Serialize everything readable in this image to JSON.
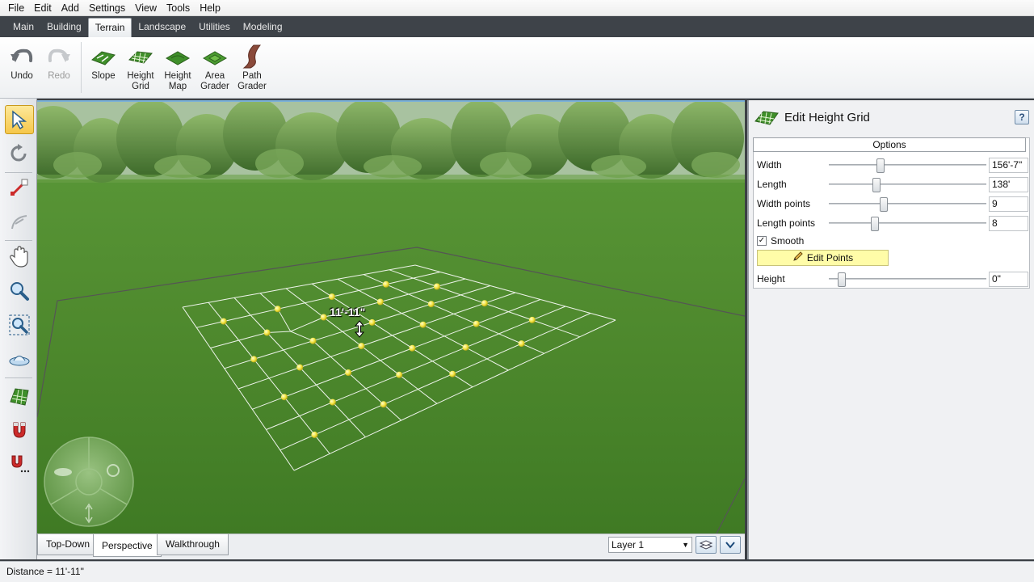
{
  "menu": [
    "File",
    "Edit",
    "Add",
    "Settings",
    "View",
    "Tools",
    "Help"
  ],
  "tabs": [
    {
      "label": "Main",
      "active": false
    },
    {
      "label": "Building",
      "active": false
    },
    {
      "label": "Terrain",
      "active": true
    },
    {
      "label": "Landscape",
      "active": false
    },
    {
      "label": "Utilities",
      "active": false
    },
    {
      "label": "Modeling",
      "active": false
    }
  ],
  "toolbar": {
    "undo": "Undo",
    "redo": "Redo",
    "slope": "Slope",
    "height_grid": "Height\nGrid",
    "height_map": "Height\nMap",
    "area_grader": "Area\nGrader",
    "path_grader": "Path\nGrader"
  },
  "left_tools": [
    "select-arrow-icon",
    "rotate-icon",
    "line-draw-icon",
    "arc-draw-icon",
    "pan-hand-icon",
    "zoom-icon",
    "zoom-extents-icon",
    "orbit-view-icon",
    "terrain-grid-icon",
    "snap-magnet-icon",
    "snap-options-icon"
  ],
  "viewport": {
    "grid_label": "11'-11\""
  },
  "view_tabs": {
    "top_down": "Top-Down",
    "perspective": "Perspective",
    "walkthrough": "Walkthrough",
    "active": "Perspective"
  },
  "layer": {
    "selected": "Layer 1"
  },
  "panel": {
    "title": "Edit Height Grid",
    "help": "?",
    "options": "Options",
    "fields": [
      {
        "label": "Width",
        "value": "156'-7\"",
        "slider": 0.33
      },
      {
        "label": "Length",
        "value": "138'",
        "slider": 0.3
      },
      {
        "label": "Width points",
        "value": "9",
        "slider": 0.35
      },
      {
        "label": "Length points",
        "value": "8",
        "slider": 0.29
      }
    ],
    "smooth_label": "Smooth",
    "smooth_checked": true,
    "edit_points": "Edit Points",
    "height": {
      "label": "Height",
      "value": "0\"",
      "slider": 0.08
    }
  },
  "status": {
    "text": "Distance = 11'-11\""
  },
  "colors": {
    "accent_tab": "#3e4349",
    "edit_points_bg": "#fffca8",
    "grass": "#4f8a2e",
    "control_point": "#f3e64a",
    "selected_point": "#cc1f2a"
  }
}
